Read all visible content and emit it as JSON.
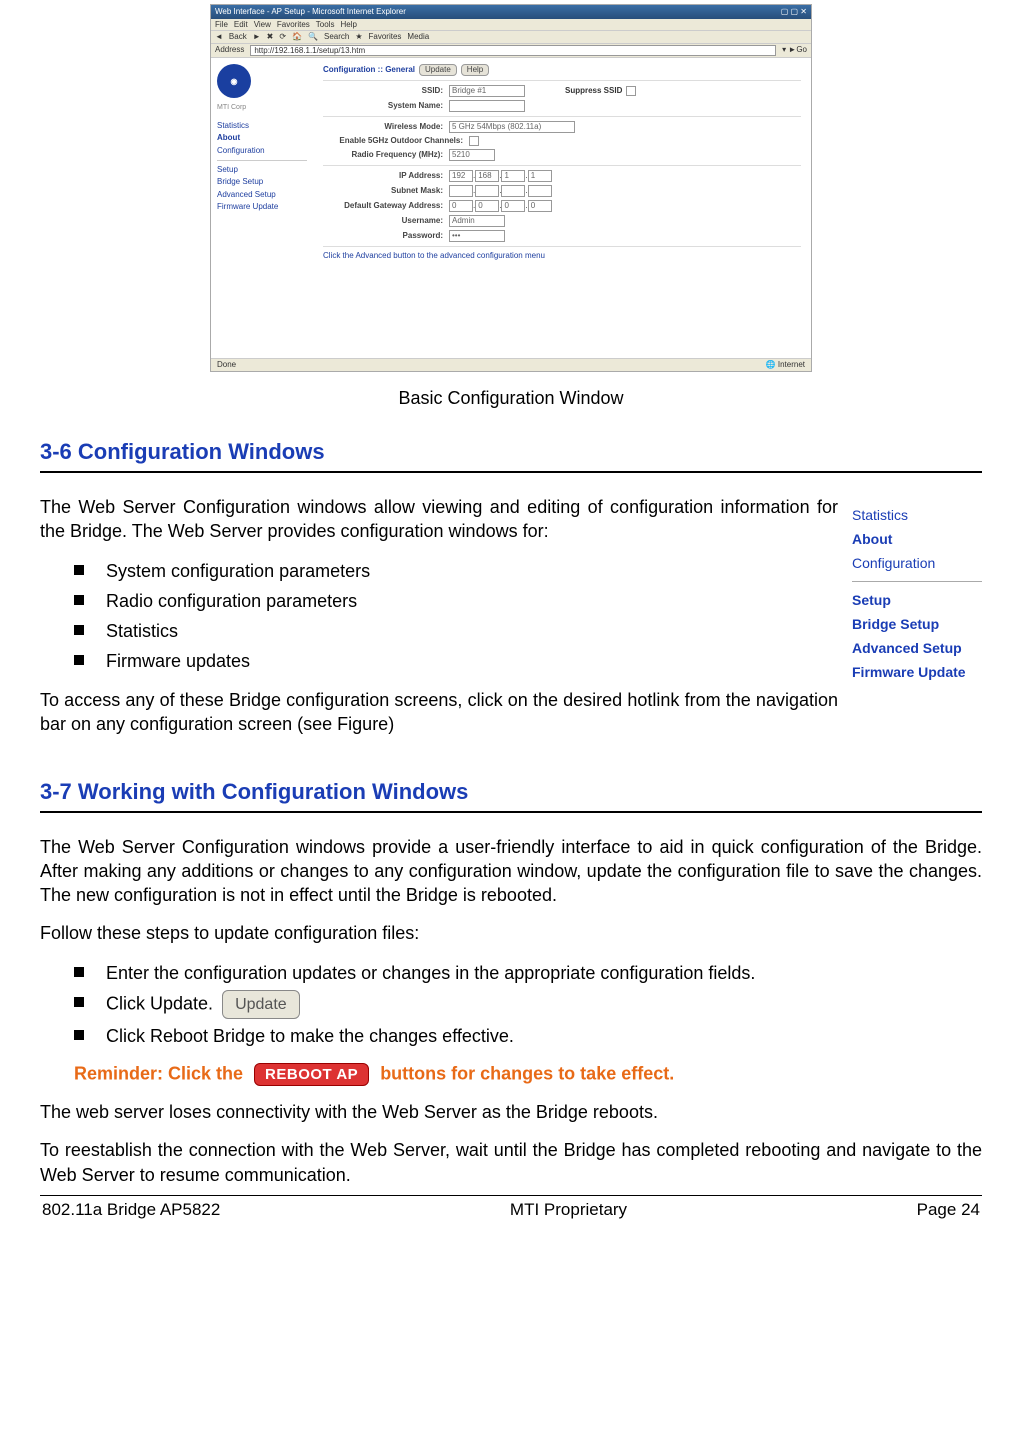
{
  "screenshot": {
    "title": "Web Interface - AP Setup - Microsoft Internet Explorer",
    "menus": [
      "File",
      "Edit",
      "View",
      "Favorites",
      "Tools",
      "Help"
    ],
    "toolbar_items": [
      "Back",
      "",
      "",
      "Search",
      "Favorites",
      "Media",
      ""
    ],
    "address_label": "Address",
    "address_value": "http://192.168.1.1/setup/13.htm",
    "sidebar": {
      "logo_text": "",
      "top_label": "MTI Corp",
      "links_top": [
        "Statistics",
        "About",
        "Configuration"
      ],
      "links_bottom": [
        "Setup",
        "Bridge Setup",
        "Advanced Setup",
        "Firmware Update"
      ]
    },
    "breadcrumb": "Configuration :: General",
    "btn_update": "Update",
    "btn_help": "Help",
    "fields": {
      "ssid_label": "SSID:",
      "ssid_value": "Bridge #1",
      "suppress_label": "Suppress SSID",
      "system_name_label": "System Name:",
      "wireless_mode_label": "Wireless Mode:",
      "wireless_mode_value": "5 GHz 54Mbps (802.11a)",
      "enable_outdoor_label": "Enable 5GHz Outdoor Channels:",
      "radio_freq_label": "Radio Frequency (MHz):",
      "radio_freq_value": "5210",
      "ip_label": "IP Address:",
      "ip_value": [
        "192",
        "168",
        "1",
        "1"
      ],
      "subnet_label": "Subnet Mask:",
      "gateway_label": "Default Gateway Address:",
      "gateway_value": [
        "0",
        "0",
        "0",
        "0"
      ],
      "username_label": "Username:",
      "username_value": "Admin",
      "password_label": "Password:",
      "password_value": "•••"
    },
    "hint_prefix": "Click the ",
    "hint_button": "Advanced",
    "hint_suffix": " button to the advanced configuration menu",
    "status_left": "Done",
    "status_right": "Internet"
  },
  "caption": "Basic Configuration Window",
  "h_36": "3-6 Configuration Windows",
  "p1": "The Web Server Configuration windows allow viewing and editing of configuration information for the Bridge. The Web Server provides configuration windows for:",
  "list1": [
    "System configuration parameters",
    "Radio configuration parameters",
    "Statistics",
    "Firmware updates"
  ],
  "p2": "To access any of these Bridge configuration screens, click on the desired hotlink from the navigation bar on any configuration screen (see Figure)",
  "nav_thumb": {
    "top": [
      "Statistics",
      "About",
      "Configuration"
    ],
    "bottom": [
      "Setup",
      "Bridge Setup",
      "Advanced Setup",
      "Firmware Update"
    ]
  },
  "h_37": "3-7 Working with Configuration Windows",
  "p3": "The Web Server Configuration windows provide a user-friendly interface to aid in quick configuration of the Bridge. After making any additions or changes to any configuration window, update the configuration file to save the changes. The new configuration is not in effect until the Bridge is rebooted.",
  "p4": "Follow these steps to update configuration files:",
  "list2": {
    "i1": "Enter the configuration updates or changes in the appropriate configuration fields.",
    "i2_text": "Click Update.",
    "i2_button": "Update",
    "i3": "Click Reboot Bridge to make the changes effective."
  },
  "reminder": {
    "pre": "Reminder: Click the ",
    "btn": "REBOOT AP",
    "post": " buttons for changes to take effect."
  },
  "p5": "The web server loses connectivity with the Web Server as the Bridge reboots.",
  "p6": "To reestablish the connection with the Web Server, wait until the Bridge has completed rebooting and navigate to the Web Server to resume communication.",
  "footer": {
    "left": "802.11a Bridge AP5822",
    "center": "MTI Proprietary",
    "right": "Page 24"
  }
}
